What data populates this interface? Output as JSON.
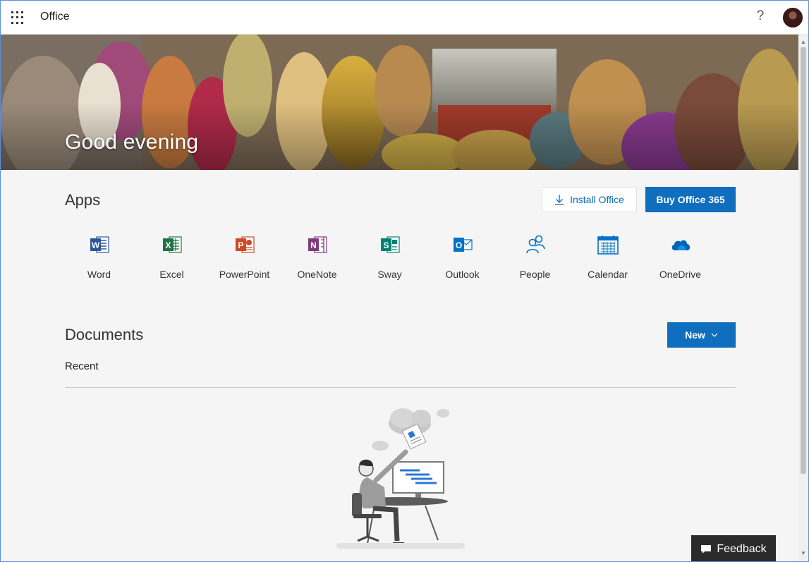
{
  "topbar": {
    "brand": "Office",
    "help_glyph": "?"
  },
  "hero": {
    "greeting": "Good evening"
  },
  "apps_section": {
    "title": "Apps",
    "install_label": "Install Office",
    "buy_label": "Buy Office 365",
    "apps": [
      {
        "label": "Word",
        "icon": "word-icon",
        "color": "#2b579a"
      },
      {
        "label": "Excel",
        "icon": "excel-icon",
        "color": "#217346"
      },
      {
        "label": "PowerPoint",
        "icon": "powerpoint-icon",
        "color": "#d24726"
      },
      {
        "label": "OneNote",
        "icon": "onenote-icon",
        "color": "#80397b"
      },
      {
        "label": "Sway",
        "icon": "sway-icon",
        "color": "#008272"
      },
      {
        "label": "Outlook",
        "icon": "outlook-icon",
        "color": "#0072c6"
      },
      {
        "label": "People",
        "icon": "people-icon",
        "color": "#0072c6"
      },
      {
        "label": "Calendar",
        "icon": "calendar-icon",
        "color": "#0072c6"
      },
      {
        "label": "OneDrive",
        "icon": "onedrive-icon",
        "color": "#0364b8"
      }
    ]
  },
  "documents_section": {
    "title": "Documents",
    "new_label": "New",
    "recent_label": "Recent"
  },
  "feedback": {
    "label": "Feedback"
  },
  "colors": {
    "primary_button": "#106ebe",
    "link_blue": "#0b6cc4",
    "page_bg": "#f4f5f4"
  }
}
